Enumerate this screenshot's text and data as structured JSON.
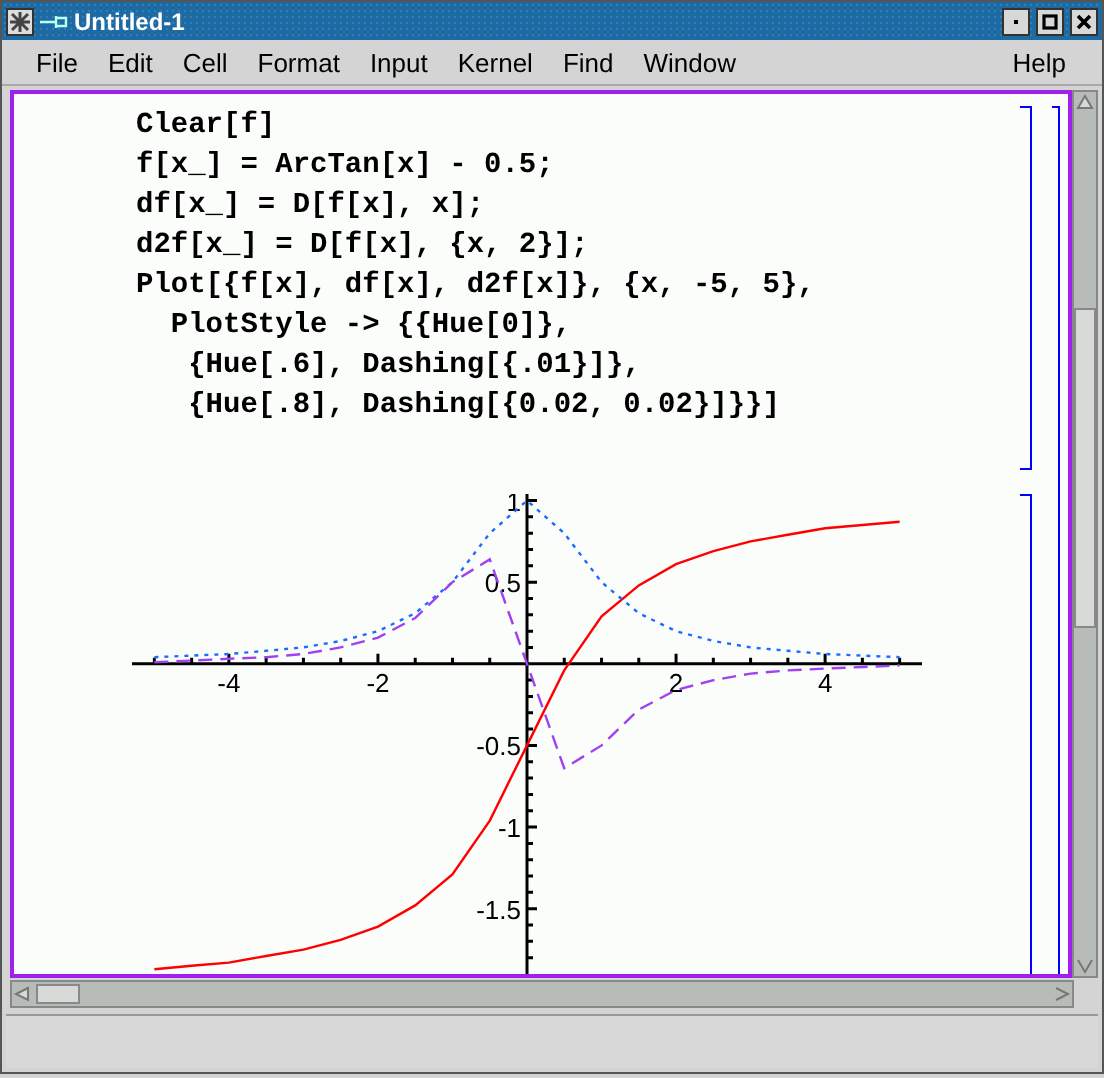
{
  "window": {
    "title": "Untitled-1"
  },
  "menu": [
    "File",
    "Edit",
    "Cell",
    "Format",
    "Input",
    "Kernel",
    "Find",
    "Window"
  ],
  "help_menu": "Help",
  "notebook": {
    "cells": [
      {
        "kind": "input",
        "text": "Clear[f]\nf[x_] = ArcTan[x] - 0.5;\ndf[x_] = D[f[x], x];\nd2f[x_] = D[f[x], {x, 2}];\nPlot[{f[x], df[x], d2f[x]}, {x, -5, 5},\n  PlotStyle -> {{Hue[0]},\n   {Hue[.6], Dashing[{.01}]},\n   {Hue[.8], Dashing[{0.02, 0.02}]}}]"
      },
      {
        "kind": "graphics",
        "chart_data": {
          "type": "line",
          "x": [
            -5,
            -4.5,
            -4,
            -3.5,
            -3,
            -2.5,
            -2,
            -1.5,
            -1,
            -0.5,
            0,
            0.5,
            1,
            1.5,
            2,
            2.5,
            3,
            3.5,
            4,
            4.5,
            5
          ],
          "xlim": [
            -5.3,
            5.3
          ],
          "ylim": [
            -1.9,
            1.04
          ],
          "xticks": [
            -4,
            -2,
            2,
            4
          ],
          "yticks": [
            -1.5,
            -1,
            -0.5,
            0.5,
            1
          ],
          "series": [
            {
              "color": "#ff0000",
              "line_style": "solid",
              "values": [
                -1.87,
                -1.85,
                -1.83,
                -1.79,
                -1.75,
                -1.69,
                -1.61,
                -1.48,
                -1.29,
                -0.96,
                -0.5,
                -0.04,
                0.29,
                0.48,
                0.61,
                0.69,
                0.75,
                0.79,
                0.83,
                0.85,
                0.87
              ]
            },
            {
              "color": "#1a6cff",
              "line_style": "dotted",
              "values": [
                0.04,
                0.05,
                0.06,
                0.08,
                0.1,
                0.14,
                0.2,
                0.31,
                0.5,
                0.8,
                1,
                0.8,
                0.5,
                0.31,
                0.2,
                0.14,
                0.1,
                0.08,
                0.06,
                0.05,
                0.04
              ]
            },
            {
              "color": "#a040f0",
              "line_style": "dashed",
              "values": [
                0.01,
                0.02,
                0.03,
                0.04,
                0.06,
                0.1,
                0.16,
                0.28,
                0.5,
                0.64,
                0,
                -0.64,
                -0.5,
                -0.28,
                -0.16,
                -0.1,
                -0.06,
                -0.04,
                -0.03,
                -0.02,
                -0.01
              ]
            }
          ]
        }
      }
    ]
  }
}
